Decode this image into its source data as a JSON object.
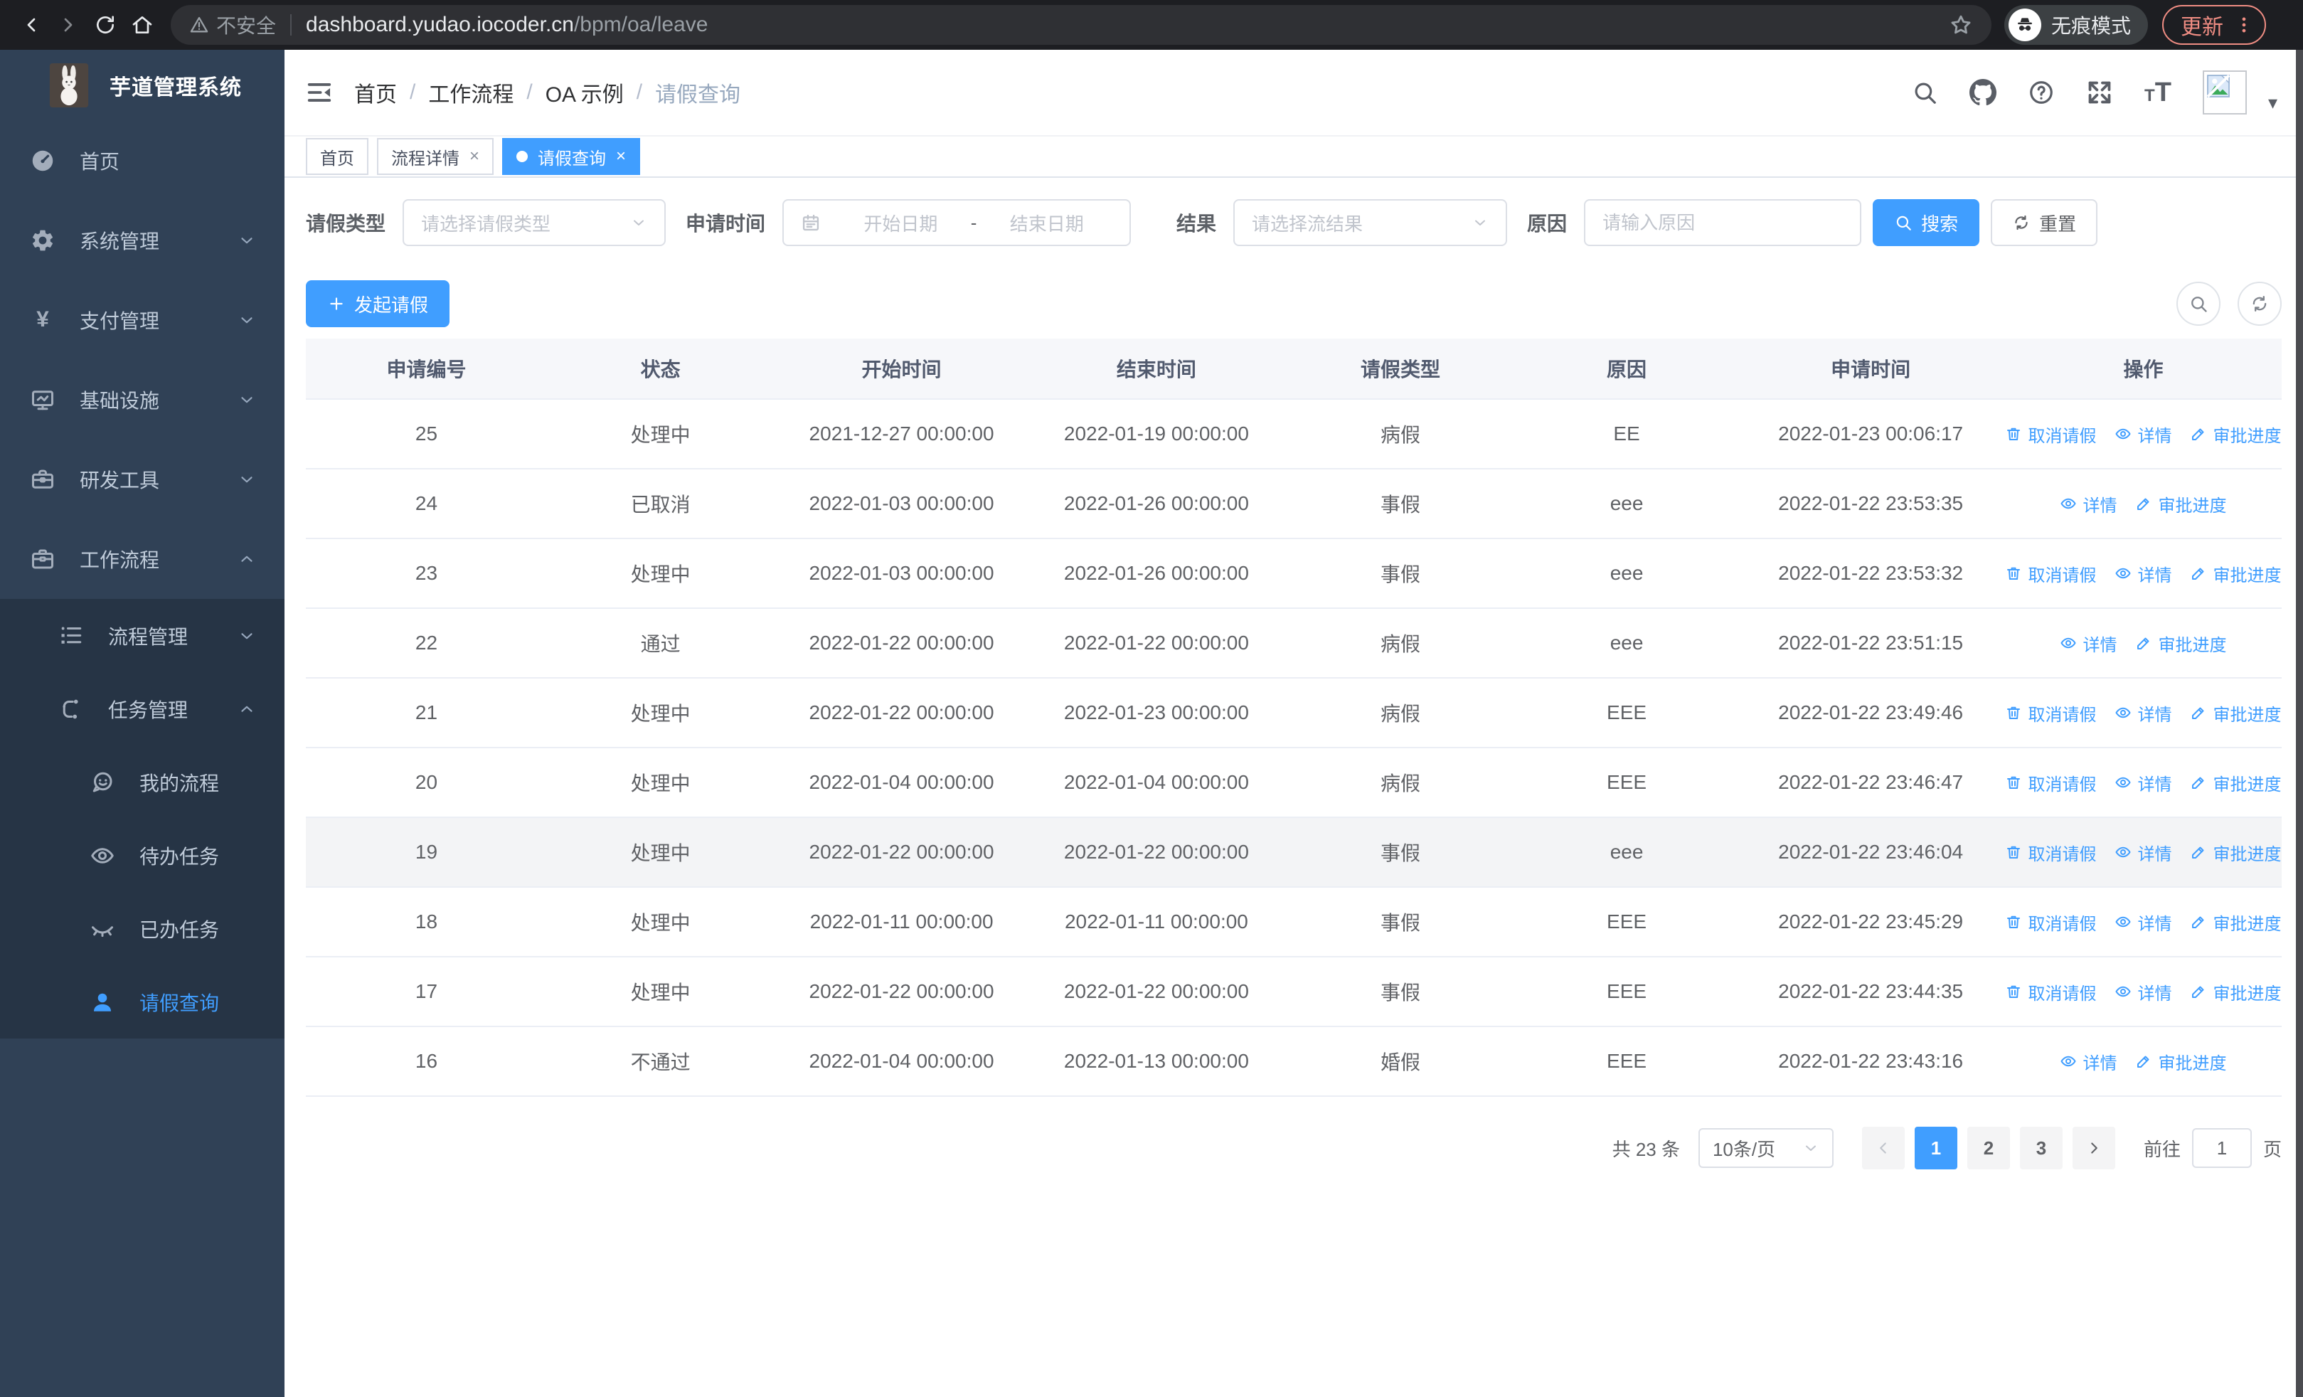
{
  "colors": {
    "primary": "#409eff",
    "sidebar_bg": "#304156",
    "submenu_bg": "#263445",
    "update_accent": "#f08d83"
  },
  "browser": {
    "security_warning": "不安全",
    "url_host": "dashboard.yudao.iocoder.cn",
    "url_path": "/bpm/oa/leave",
    "incognito_label": "无痕模式",
    "update_label": "更新"
  },
  "sidebar": {
    "app_title": "芋道管理系统",
    "items": [
      {
        "label": "首页",
        "icon": "dashboard-icon",
        "arrow": ""
      },
      {
        "label": "系统管理",
        "icon": "gear-icon",
        "arrow": "down"
      },
      {
        "label": "支付管理",
        "icon": "yen-icon",
        "arrow": "down"
      },
      {
        "label": "基础设施",
        "icon": "monitor-icon",
        "arrow": "down"
      },
      {
        "label": "研发工具",
        "icon": "toolbox-icon",
        "arrow": "down"
      },
      {
        "label": "工作流程",
        "icon": "briefcase-icon",
        "arrow": "up"
      }
    ],
    "submenu": [
      {
        "label": "流程管理",
        "icon": "list-icon",
        "arrow": "down",
        "level": 2,
        "active": false
      },
      {
        "label": "任务管理",
        "icon": "tree-icon",
        "arrow": "up",
        "level": 2,
        "active": false
      },
      {
        "label": "我的流程",
        "icon": "chat-icon",
        "arrow": "",
        "level": 3,
        "active": false
      },
      {
        "label": "待办任务",
        "icon": "eye-icon",
        "arrow": "",
        "level": 3,
        "active": false
      },
      {
        "label": "已办任务",
        "icon": "eye-closed-icon",
        "arrow": "",
        "level": 3,
        "active": false
      },
      {
        "label": "请假查询",
        "icon": "user-icon",
        "arrow": "",
        "level": 3,
        "active": true
      }
    ]
  },
  "header": {
    "breadcrumb_separator": "/",
    "breadcrumb": [
      {
        "label": "首页",
        "current": false
      },
      {
        "label": "工作流程",
        "current": false
      },
      {
        "label": "OA 示例",
        "current": false
      },
      {
        "label": "请假查询",
        "current": true
      }
    ]
  },
  "tabs": [
    {
      "label": "首页",
      "closable": false,
      "active": false
    },
    {
      "label": "流程详情",
      "closable": true,
      "active": false
    },
    {
      "label": "请假查询",
      "closable": true,
      "active": true
    }
  ],
  "filters": {
    "leave_type_label": "请假类型",
    "leave_type_placeholder": "请选择请假类型",
    "apply_time_label": "申请时间",
    "date_start_placeholder": "开始日期",
    "date_separator": "-",
    "date_end_placeholder": "结束日期",
    "result_label": "结果",
    "result_placeholder": "请选择流结果",
    "reason_label": "原因",
    "reason_placeholder": "请输入原因",
    "search_button": "搜索",
    "reset_button": "重置"
  },
  "toolbar": {
    "create_button": "发起请假"
  },
  "table": {
    "columns": [
      "申请编号",
      "状态",
      "开始时间",
      "结束时间",
      "请假类型",
      "原因",
      "申请时间",
      "操作"
    ],
    "action_labels": {
      "cancel": "取消请假",
      "detail": "详情",
      "progress": "审批进度"
    },
    "rows": [
      {
        "id": "25",
        "status": "处理中",
        "start": "2021-12-27 00:00:00",
        "end": "2022-01-19 00:00:00",
        "type": "病假",
        "reason": "EE",
        "applied": "2022-01-23 00:06:17",
        "actions": [
          "cancel",
          "detail",
          "progress"
        ],
        "highlight": false
      },
      {
        "id": "24",
        "status": "已取消",
        "start": "2022-01-03 00:00:00",
        "end": "2022-01-26 00:00:00",
        "type": "事假",
        "reason": "eee",
        "applied": "2022-01-22 23:53:35",
        "actions": [
          "detail",
          "progress"
        ],
        "highlight": false
      },
      {
        "id": "23",
        "status": "处理中",
        "start": "2022-01-03 00:00:00",
        "end": "2022-01-26 00:00:00",
        "type": "事假",
        "reason": "eee",
        "applied": "2022-01-22 23:53:32",
        "actions": [
          "cancel",
          "detail",
          "progress"
        ],
        "highlight": false
      },
      {
        "id": "22",
        "status": "通过",
        "start": "2022-01-22 00:00:00",
        "end": "2022-01-22 00:00:00",
        "type": "病假",
        "reason": "eee",
        "applied": "2022-01-22 23:51:15",
        "actions": [
          "detail",
          "progress"
        ],
        "highlight": false
      },
      {
        "id": "21",
        "status": "处理中",
        "start": "2022-01-22 00:00:00",
        "end": "2022-01-23 00:00:00",
        "type": "病假",
        "reason": "EEE",
        "applied": "2022-01-22 23:49:46",
        "actions": [
          "cancel",
          "detail",
          "progress"
        ],
        "highlight": false
      },
      {
        "id": "20",
        "status": "处理中",
        "start": "2022-01-04 00:00:00",
        "end": "2022-01-04 00:00:00",
        "type": "病假",
        "reason": "EEE",
        "applied": "2022-01-22 23:46:47",
        "actions": [
          "cancel",
          "detail",
          "progress"
        ],
        "highlight": false
      },
      {
        "id": "19",
        "status": "处理中",
        "start": "2022-01-22 00:00:00",
        "end": "2022-01-22 00:00:00",
        "type": "事假",
        "reason": "eee",
        "applied": "2022-01-22 23:46:04",
        "actions": [
          "cancel",
          "detail",
          "progress"
        ],
        "highlight": true
      },
      {
        "id": "18",
        "status": "处理中",
        "start": "2022-01-11 00:00:00",
        "end": "2022-01-11 00:00:00",
        "type": "事假",
        "reason": "EEE",
        "applied": "2022-01-22 23:45:29",
        "actions": [
          "cancel",
          "detail",
          "progress"
        ],
        "highlight": false
      },
      {
        "id": "17",
        "status": "处理中",
        "start": "2022-01-22 00:00:00",
        "end": "2022-01-22 00:00:00",
        "type": "事假",
        "reason": "EEE",
        "applied": "2022-01-22 23:44:35",
        "actions": [
          "cancel",
          "detail",
          "progress"
        ],
        "highlight": false
      },
      {
        "id": "16",
        "status": "不通过",
        "start": "2022-01-04 00:00:00",
        "end": "2022-01-13 00:00:00",
        "type": "婚假",
        "reason": "EEE",
        "applied": "2022-01-22 23:43:16",
        "actions": [
          "detail",
          "progress"
        ],
        "highlight": false
      }
    ]
  },
  "pagination": {
    "total_text": "共 23 条",
    "page_size": "10条/页",
    "pages": [
      "1",
      "2",
      "3"
    ],
    "active_page": "1",
    "goto_label": "前往",
    "goto_value": "1",
    "goto_suffix": "页"
  }
}
